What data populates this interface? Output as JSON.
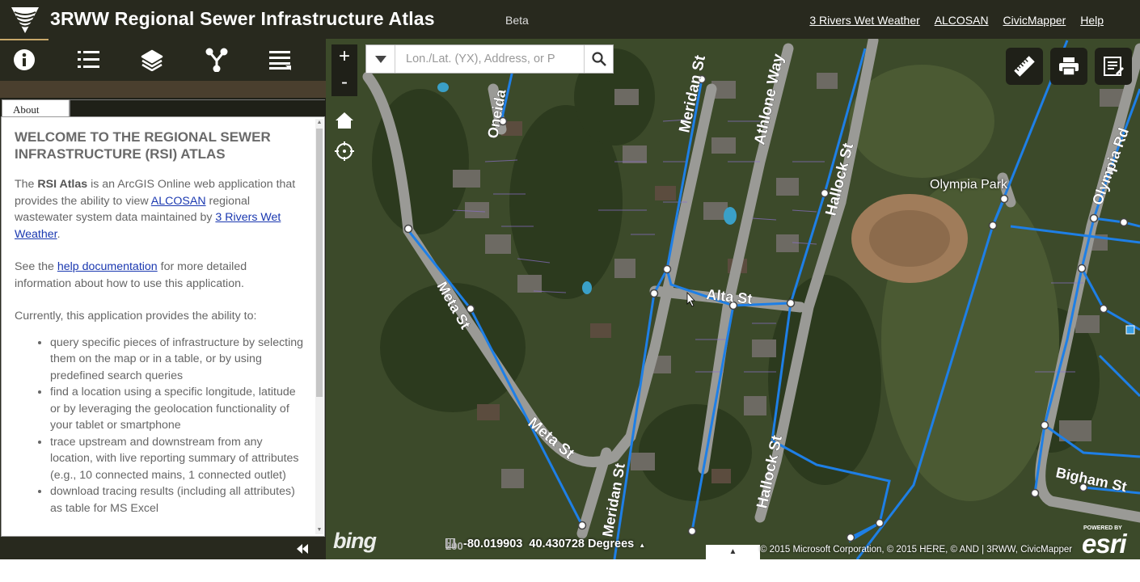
{
  "header": {
    "title": "3RWW Regional Sewer Infrastructure Atlas",
    "beta": "Beta",
    "links": [
      "3 Rivers Wet Weather",
      "ALCOSAN",
      "CivicMapper",
      "Help"
    ]
  },
  "toolbar": {
    "items": [
      "info-icon",
      "list-icon",
      "layers-icon",
      "trace-icon",
      "menu-icon"
    ]
  },
  "panel": {
    "tab": "About",
    "heading": "WELCOME TO THE REGIONAL SEWER INFRASTRUCTURE (RSI) ATLAS",
    "p1_a": "The ",
    "p1_b": "RSI Atlas",
    "p1_c": " is an ArcGIS Online web application that provides the ability to view ",
    "p1_link1": "ALCOSAN",
    "p1_d": " regional wastewater system data maintained by ",
    "p1_link2": "3 Rivers Wet Weather",
    "p1_e": ".",
    "p2_a": "See the ",
    "p2_link": "help documentation",
    "p2_b": " for more detailed information about how to use this application.",
    "p3": "Currently, this application provides the ability to:",
    "bullets": [
      "query specific pieces of infrastructure by selecting them on the map or in a table, or by using predefined search queries",
      "find a location using a specific longitude, latitude or by leveraging the geolocation functionality of your tablet or smartphone",
      "trace upstream and downstream from any location, with live reporting summary of attributes (e.g., 10 connected mains, 1 connected outlet)",
      "download tracing results (including all attributes) as table for MS Excel"
    ]
  },
  "map": {
    "zoom_in": "+",
    "zoom_out": "-",
    "search_placeholder": "Lon./Lat. (YX), Address, or P",
    "coordinates": "-80.019903  40.430728 Degrees",
    "scale_label": "200",
    "attribution": "© 2015 Microsoft Corporation, © 2015 HERE, © AND | 3RWW, CivicMapper",
    "bing": "bing",
    "esri_powered": "POWERED BY",
    "esri": "esri",
    "expand": "▲",
    "place_labels": {
      "park": "Olympia Park",
      "s1": "Oneida",
      "s2": "Meridan St",
      "s3": "Athlone Way",
      "s4": "Hallock St",
      "s5": "Olympia Rd",
      "s6": "Meta St",
      "s7": "Alta St",
      "s8": "Meta St",
      "s9": "Meridan St",
      "s10": "Hallock St",
      "s11": "Bigham St"
    }
  },
  "colors": {
    "header_bg": "#28291e",
    "sewer_line": "#1e7fe6",
    "link": "#1a38b0"
  }
}
